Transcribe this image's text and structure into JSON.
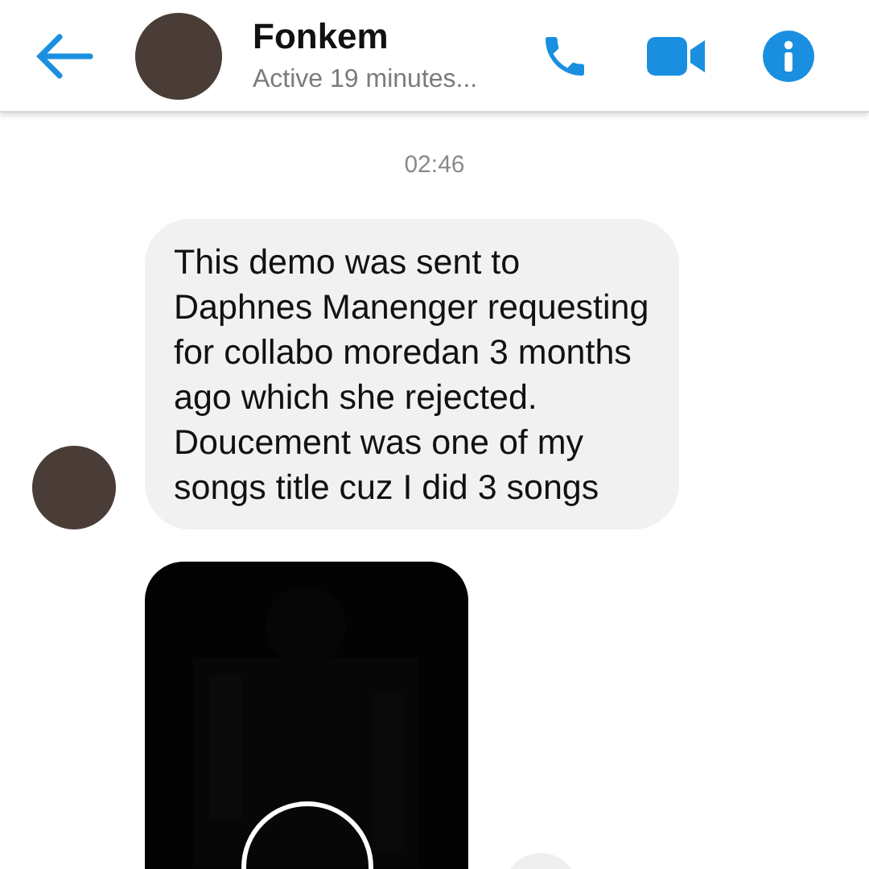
{
  "header": {
    "name": "Fonkem",
    "status": "Active 19 minutes..."
  },
  "timestamp": "02:46",
  "messages": [
    {
      "kind": "text",
      "text": "This demo was sent to Daphnes Manenger requesting for collabo moredan 3 months ago which she rejected. Doucement was one of my songs title cuz I did 3 songs"
    },
    {
      "kind": "video"
    }
  ]
}
